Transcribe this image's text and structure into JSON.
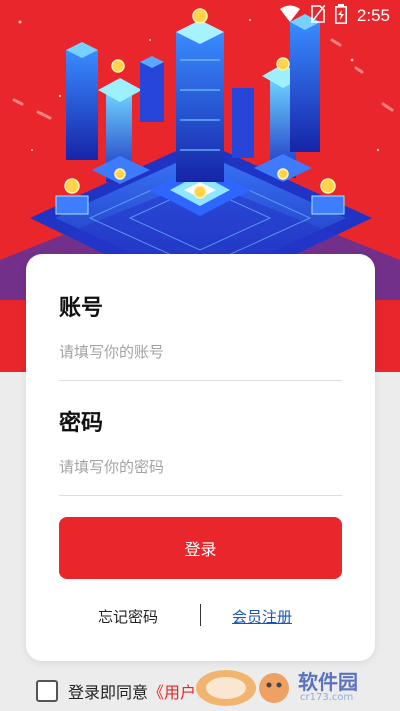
{
  "status_bar": {
    "time": "2:55"
  },
  "login": {
    "account_label": "账号",
    "account_placeholder": "请填写你的账号",
    "password_label": "密码",
    "password_placeholder": "请填写你的密码",
    "login_button": "登录",
    "forgot_password": "忘记密码",
    "register": "会员注册"
  },
  "agreement": {
    "prefix": "登录即同意",
    "link": "《用户"
  },
  "watermark": {
    "text": "软件园",
    "subtext": "cr173.com"
  },
  "colors": {
    "brand_red": "#e8262b",
    "link_blue": "#1a55b8",
    "background": "#ececec"
  }
}
